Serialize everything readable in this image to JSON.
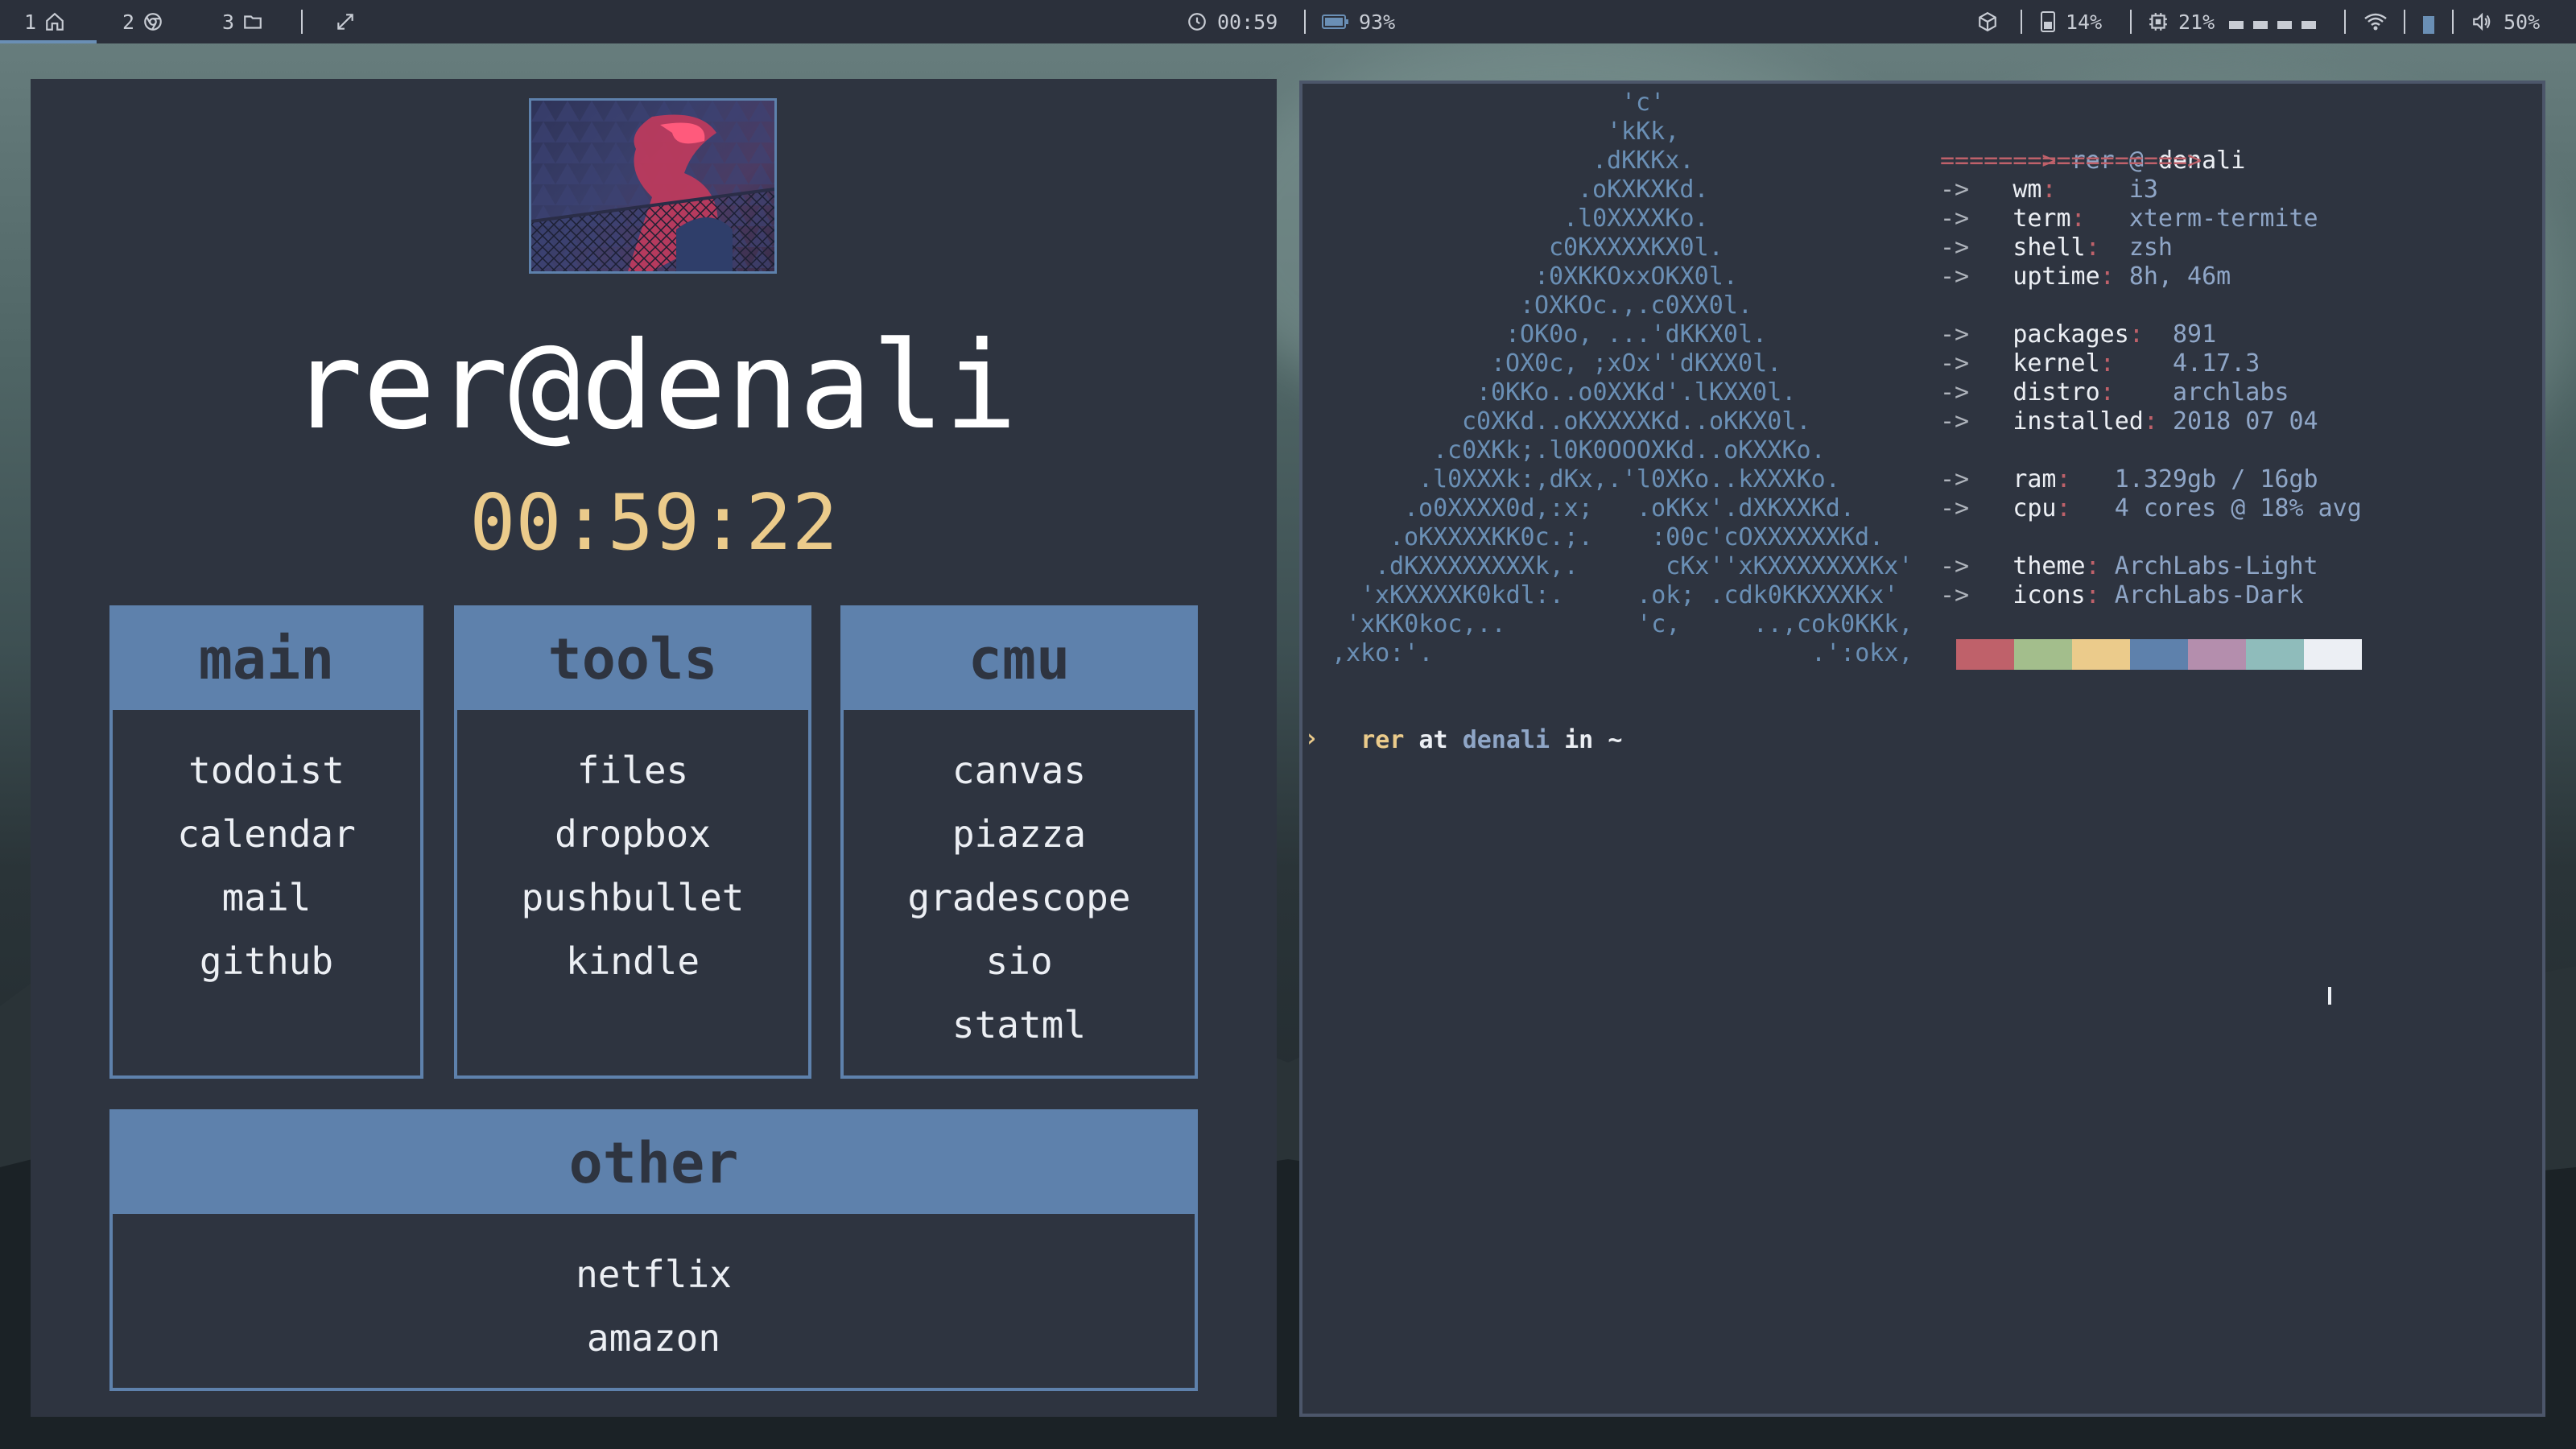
{
  "topbar": {
    "workspaces": [
      {
        "num": "1",
        "icon": "home-icon"
      },
      {
        "num": "2",
        "icon": "browser-icon"
      },
      {
        "num": "3",
        "icon": "folder-icon"
      }
    ],
    "clock": "00:59",
    "battery": "93%",
    "disk": "14%",
    "cpu": "21%",
    "volume": "50%"
  },
  "startpage": {
    "hostname": "rer@denali",
    "clock": "00:59:22",
    "panels": [
      {
        "title": "main",
        "links": [
          "todoist",
          "calendar",
          "mail",
          "github"
        ]
      },
      {
        "title": "tools",
        "links": [
          "files",
          "dropbox",
          "pushbullet",
          "kindle"
        ]
      },
      {
        "title": "cmu",
        "links": [
          "canvas",
          "piazza",
          "gradescope",
          "sio",
          "statml"
        ]
      },
      {
        "title": "other",
        "links": [
          "netflix",
          "amazon"
        ]
      }
    ]
  },
  "terminal": {
    "ascii_art": [
      "'c'",
      "'kKk,",
      ".dKKKx.",
      ".oKXKXKd.",
      ".l0XXXXKo.",
      "c0KXXXXKX0l.",
      ":0XKKOxxOKX0l.",
      ":OXKOc.,.c0XX0l.",
      ":OK0o, ...'dKKX0l.",
      ":OX0c, ;xOx''dKXX0l.",
      ":0KKo..o0XXKd'.lKXX0l.",
      "c0XKd..oKXXXXKd..oKKX0l.",
      ".c0XKk;.l0K0OOOXKd..oKXXKo.",
      ".l0XXXk:,dKx,.'l0XKo..kXXXKo.",
      ".o0XXXX0d,:x;   .oKKx'.dXKXXKd.",
      ".oKXXXXKK0c.;.    :00c'cOXXXXXXKd.",
      ".dKXXXXXXXXk,.      cKx''xKXXXXXXXKx'",
      "'xKXXXXK0kdl:.     .ok; .cdk0KKXXXKx'",
      "'xKK0koc,..         'c,     ..,cok0KKk,",
      ",xko:'.                          .':okx,"
    ],
    "info": {
      "header_arrow": "===>",
      "user": "rer",
      "at": "@",
      "host": "denali",
      "rule": "=================>",
      "rows": [
        {
          "key": "wm",
          "val": "i3"
        },
        {
          "key": "term",
          "val": "xterm-termite"
        },
        {
          "key": "shell",
          "val": "zsh"
        },
        {
          "key": "uptime",
          "val": "8h, 46m"
        },
        {
          "key": "packages",
          "val": "891"
        },
        {
          "key": "kernel",
          "val": "4.17.3"
        },
        {
          "key": "distro",
          "val": "archlabs"
        },
        {
          "key": "installed",
          "val": "2018 07 04"
        },
        {
          "key": "ram",
          "val": "1.329gb / 16gb"
        },
        {
          "key": "cpu",
          "val": "4 cores @ 18% avg"
        },
        {
          "key": "theme",
          "val": "ArchLabs-Light"
        },
        {
          "key": "icons",
          "val": "ArchLabs-Dark"
        }
      ]
    },
    "arrow": "->",
    "palette": [
      "#bf616a",
      "#a3be8c",
      "#ebcb8b",
      "#5e81ac",
      "#b48ead",
      "#8fbcbb",
      "#eceff4"
    ],
    "prompt": {
      "user": "rer",
      "at": "at",
      "host": "denali",
      "in": "in",
      "dir": "~",
      "symbol": "›"
    }
  }
}
